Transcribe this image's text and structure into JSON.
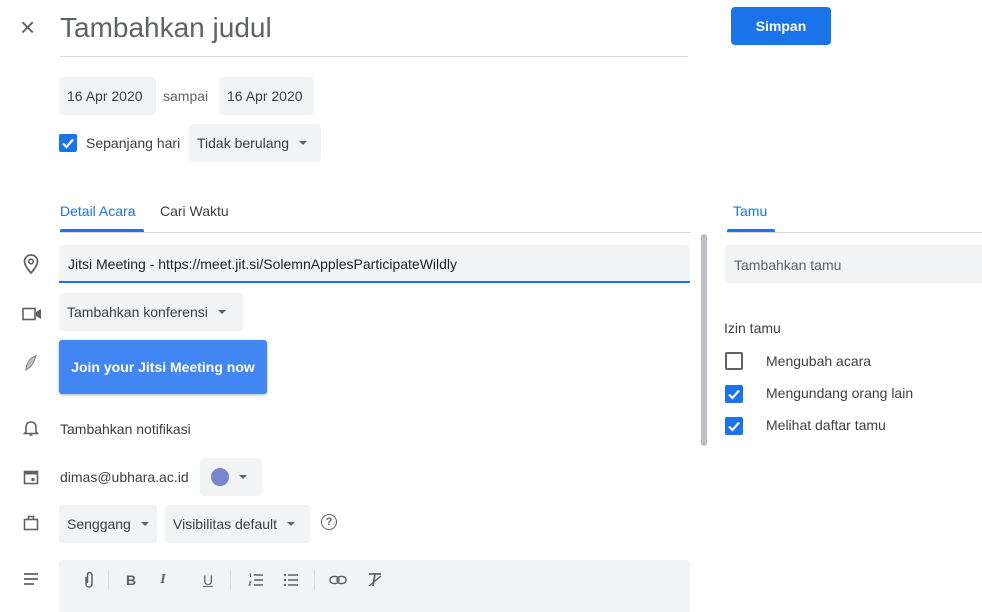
{
  "header": {
    "close_glyph": "×",
    "title_placeholder": "Tambahkan judul",
    "save_label": "Simpan"
  },
  "dates": {
    "start": "16 Apr 2020",
    "to_label": "sampai",
    "end": "16 Apr 2020"
  },
  "options": {
    "all_day_label": "Sepanjang hari",
    "all_day_checked": true,
    "repeat": "Tidak berulang"
  },
  "tabs": [
    {
      "label": "Detail Acara",
      "active": true
    },
    {
      "label": "Cari Waktu",
      "active": false
    }
  ],
  "location": "Jitsi Meeting - https://meet.jit.si/SolemnApplesParticipateWildly",
  "conference": {
    "label": "Tambahkan konferensi"
  },
  "jitsi_button": "Join your Jitsi Meeting now",
  "notification": "Tambahkan notifikasi",
  "calendar": {
    "owner": "dimas@ubhara.ac.id",
    "color": "#7986cb"
  },
  "availability": {
    "busy": "Senggang",
    "visibility": "Visibilitas default",
    "help": "?"
  },
  "toolbar": {
    "bold": "B",
    "italic": "I",
    "underline": "U"
  },
  "guests": {
    "tab_label": "Tamu",
    "add_placeholder": "Tambahkan tamu",
    "permissions_title": "Izin tamu",
    "permissions": [
      {
        "label": "Mengubah acara",
        "checked": false
      },
      {
        "label": "Mengundang orang lain",
        "checked": true
      },
      {
        "label": "Melihat daftar tamu",
        "checked": true
      }
    ]
  },
  "colors": {
    "accent": "#1a73e8",
    "chip_bg": "#f1f3f4",
    "text": "#3c4043",
    "icon": "#5f6368"
  }
}
